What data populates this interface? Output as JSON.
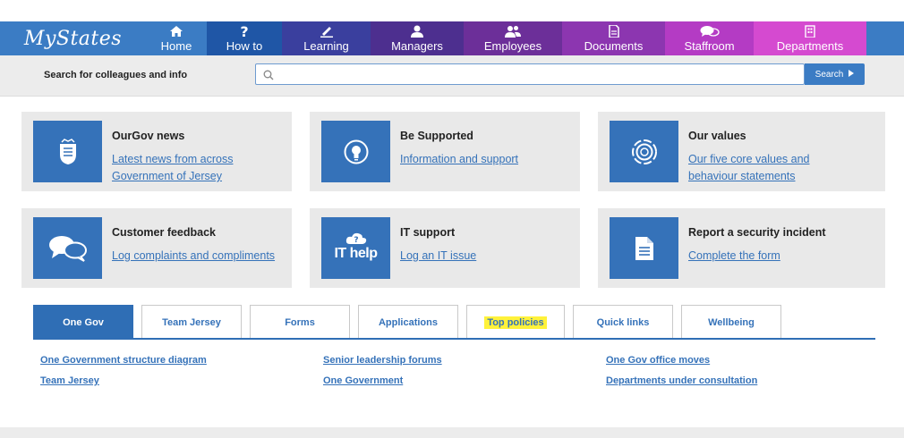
{
  "logo": {
    "text": "MyStates"
  },
  "nav": [
    {
      "id": "home",
      "label": "Home",
      "icon": "home-icon",
      "color": "#3b7cc4"
    },
    {
      "id": "howto",
      "label": "How to",
      "icon": "question-icon",
      "color": "#1f56a6"
    },
    {
      "id": "learning",
      "label": "Learning",
      "icon": "pencil-icon",
      "color": "#3a3f9e"
    },
    {
      "id": "managers",
      "label": "Managers",
      "icon": "user-icon",
      "color": "#4d2f8f"
    },
    {
      "id": "employees",
      "label": "Employees",
      "icon": "users-icon",
      "color": "#6c2f99"
    },
    {
      "id": "documents",
      "label": "Documents",
      "icon": "document-icon",
      "color": "#8c36b0"
    },
    {
      "id": "staffroom",
      "label": "Staffroom",
      "icon": "chat-icon",
      "color": "#b43bc4"
    },
    {
      "id": "departments",
      "label": "Departments",
      "icon": "building-icon",
      "color": "#d54ad0"
    }
  ],
  "search": {
    "label": "Search for colleagues and info",
    "placeholder": "",
    "button": "Search"
  },
  "cards": [
    {
      "title": "OurGov news",
      "link": "Latest news from across Government of Jersey",
      "icon": "crest-icon"
    },
    {
      "title": "Be Supported",
      "link": "Information and support",
      "icon": "lightbulb-icon"
    },
    {
      "title": "Our values",
      "link": "Our five core values and behaviour statements",
      "icon": "circular-arrows-icon"
    },
    {
      "title": "Customer feedback",
      "link": "Log complaints and compliments",
      "icon": "speech-bubbles-icon"
    },
    {
      "title": "IT support",
      "link": "Log an IT issue",
      "icon": "it-help-icon",
      "tile_text": "IT help"
    },
    {
      "title": "Report a security incident",
      "link": "Complete the form",
      "icon": "form-document-icon"
    }
  ],
  "tabs": [
    {
      "label": "One Gov",
      "active": true
    },
    {
      "label": "Team Jersey",
      "active": false
    },
    {
      "label": "Forms",
      "active": false
    },
    {
      "label": "Applications",
      "active": false
    },
    {
      "label": "Top policies",
      "active": false,
      "highlighted": true
    },
    {
      "label": "Quick links",
      "active": false
    },
    {
      "label": "Wellbeing",
      "active": false
    }
  ],
  "tab_links": [
    "One Government structure diagram",
    "Team Jersey",
    "Senior leadership forums",
    "One Government",
    "One Gov office moves",
    "Departments under consultation"
  ]
}
